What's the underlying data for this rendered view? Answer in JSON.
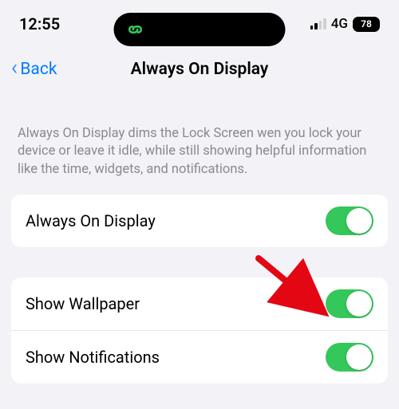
{
  "status_bar": {
    "time": "12:55",
    "network_type": "4G",
    "battery_percent": "78"
  },
  "nav": {
    "back_label": "Back",
    "title": "Always On Display"
  },
  "description": "Always On Display dims the Lock Screen wen you lock your device or leave it idle, while still showing helpful information like the time, widgets, and notifications.",
  "rows": {
    "main": {
      "label": "Always On Display",
      "on": true
    },
    "wallpaper": {
      "label": "Show Wallpaper",
      "on": true
    },
    "notifications": {
      "label": "Show Notifications",
      "on": true
    }
  },
  "colors": {
    "accent_blue": "#007aff",
    "toggle_green": "#34c759",
    "island_green": "#34c759"
  }
}
